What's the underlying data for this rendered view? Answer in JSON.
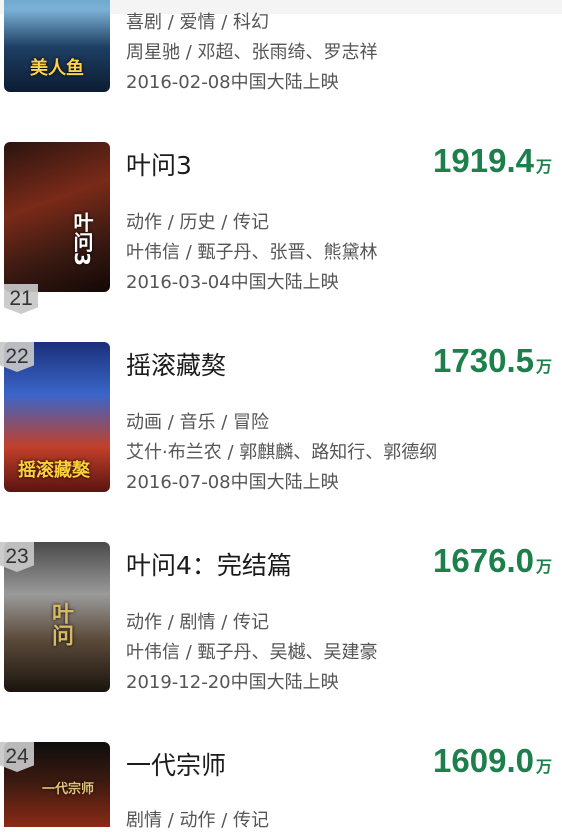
{
  "items": [
    {
      "genre": "喜剧 / 爱情 / 科幻",
      "cast": "周星驰 / 邓超、张雨绮、罗志祥",
      "release": "2016-02-08中国大陆上映",
      "poster_text": "美人鱼"
    },
    {
      "rank": "21",
      "title": "叶问3",
      "box_value": "1919.4",
      "box_unit": "万",
      "genre": "动作 / 历史 / 传记",
      "cast": "叶伟信 / 甄子丹、张晋、熊黛林",
      "release": "2016-03-04中国大陆上映",
      "poster_text": "叶问3"
    },
    {
      "rank": "22",
      "title": "摇滚藏獒",
      "box_value": "1730.5",
      "box_unit": "万",
      "genre": "动画 / 音乐 / 冒险",
      "cast": "艾什·布兰农 / 郭麒麟、路知行、郭德纲",
      "release": "2016-07-08中国大陆上映",
      "poster_text": "摇滚藏獒"
    },
    {
      "rank": "23",
      "title": "叶问4：完结篇",
      "box_value": "1676.0",
      "box_unit": "万",
      "genre": "动作 / 剧情 / 传记",
      "cast": "叶伟信 / 甄子丹、吴樾、吴建豪",
      "release": "2019-12-20中国大陆上映",
      "poster_text": "叶问"
    },
    {
      "rank": "24",
      "title": "一代宗师",
      "box_value": "1609.0",
      "box_unit": "万",
      "genre": "剧情 / 动作 / 传记",
      "poster_text": "一代宗师"
    }
  ],
  "colors": {
    "box_green": "#1d7f4b",
    "title_text": "#1b1b1b",
    "meta_text": "#555555"
  }
}
